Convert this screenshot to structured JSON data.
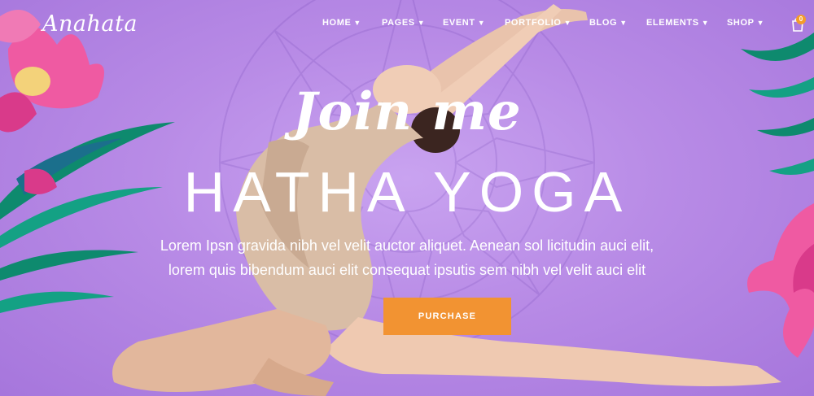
{
  "brand": {
    "logo_text": "Anahata"
  },
  "nav": {
    "items": [
      {
        "label": "HOME"
      },
      {
        "label": "PAGES"
      },
      {
        "label": "EVENT"
      },
      {
        "label": "PORTFOLIO"
      },
      {
        "label": "BLOG"
      },
      {
        "label": "ELEMENTS"
      },
      {
        "label": "SHOP"
      }
    ],
    "chevron_icon": "chevron-down-icon",
    "cart": {
      "icon": "shopping-bag-icon",
      "count": "0"
    }
  },
  "hero": {
    "script_heading": "Join me",
    "title": "HATHA YOGA",
    "description_line1": "Lorem Ipsn gravida nibh vel velit auctor aliquet. Aenean sol licitudin auci elit,",
    "description_line2": "lorem quis bibendum auci elit consequat ipsutis sem nibh vel velit auci elit",
    "cta_label": "PURCHASE"
  },
  "colors": {
    "background": "#b98ee6",
    "accent": "#f29332",
    "leaf": "#0e8a6e",
    "flower": "#ec4f9c"
  }
}
